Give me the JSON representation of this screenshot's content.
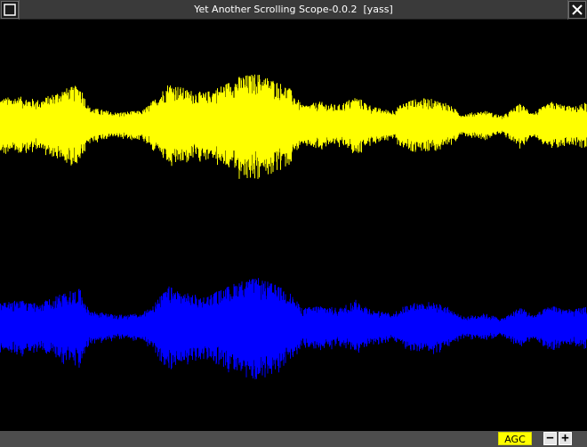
{
  "window": {
    "title": "Yet Another Scrolling Scope-0.0.2  [yass]"
  },
  "controls": {
    "agc_label": "AGC",
    "zoom_out_label": "−",
    "zoom_in_label": "+"
  },
  "icons": {
    "window_menu": "window-menu-icon",
    "close": "close-icon"
  },
  "colors": {
    "titlebar": "#3a3a3a",
    "background": "#000000",
    "statusbar": "#4d4d4d",
    "channel_1": "#ffff00",
    "channel_2": "#0000ff",
    "agc_active": "#ffff00"
  },
  "scope": {
    "channels": [
      {
        "name": "channel-1",
        "color": "#ffff00"
      },
      {
        "name": "channel-2",
        "color": "#0000ff"
      }
    ]
  }
}
